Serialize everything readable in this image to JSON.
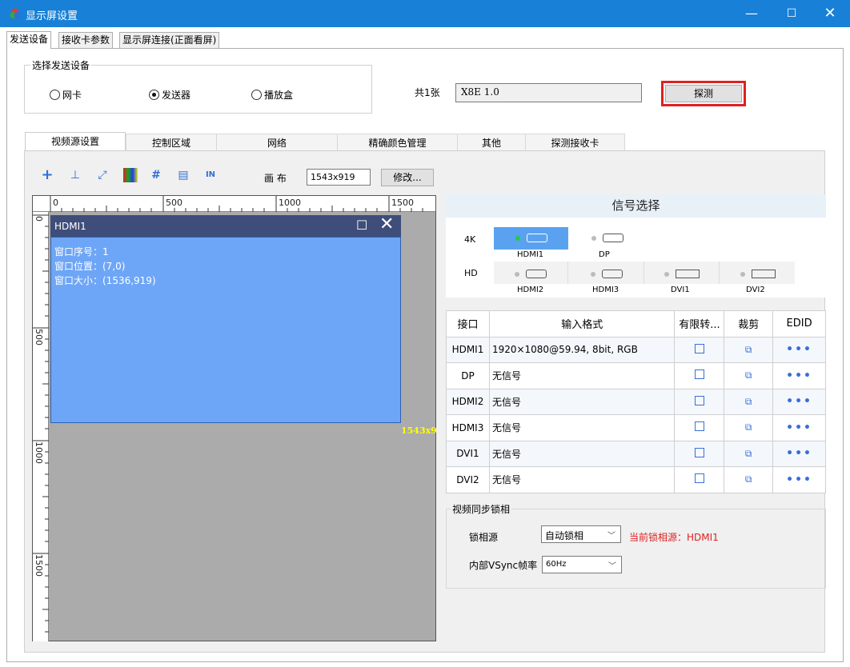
{
  "window": {
    "title": "显示屏设置",
    "min": "—",
    "max": "☐",
    "close": "✕"
  },
  "top_tabs": [
    "发送设备",
    "接收卡参数",
    "显示屏连接(正面看屏)"
  ],
  "device_group": {
    "title": "选择发送设备",
    "options": [
      "网卡",
      "发送器",
      "播放盒"
    ],
    "selected": "发送器",
    "count_label": "共1张",
    "model": "X8E 1.0",
    "detect_button": "探测"
  },
  "inner_tabs": [
    "视频源设置",
    "控制区域",
    "网络",
    "精确颜色管理",
    "其他",
    "探测接收卡"
  ],
  "toolbar": {
    "icons": [
      "add-icon",
      "import-icon",
      "fit-icon",
      "color-bar-icon",
      "grid-icon",
      "layout-icon",
      "input-icon"
    ],
    "canvas_label": "画 布",
    "canvas_size": "1543x919",
    "modify_button": "修改..."
  },
  "ruler": {
    "top": [
      "0",
      "500",
      "1000",
      "1500"
    ],
    "left": [
      "0",
      "500",
      "1000",
      "1500"
    ]
  },
  "window_item": {
    "name": "HDMI1",
    "index": "窗口序号：1",
    "position": "窗口位置：(7,0)",
    "size": "窗口大小：(1536,919)",
    "canvas_overlay": "1543x9"
  },
  "signal": {
    "title": "信号选择",
    "row_4k": "4K",
    "row_hd": "HD",
    "ports_4k": [
      "HDMI1",
      "DP"
    ],
    "ports_hd": [
      "HDMI2",
      "HDMI3",
      "DVI1",
      "DVI2"
    ],
    "active": "HDMI1"
  },
  "table": {
    "headers": [
      "接口",
      "输入格式",
      "有限转...",
      "裁剪",
      "EDID"
    ],
    "rows": [
      {
        "port": "HDMI1",
        "format": "1920×1080@59.94, 8bit, RGB"
      },
      {
        "port": "DP",
        "format": "无信号"
      },
      {
        "port": "HDMI2",
        "format": "无信号"
      },
      {
        "port": "HDMI3",
        "format": "无信号"
      },
      {
        "port": "DVI1",
        "format": "无信号"
      },
      {
        "port": "DVI2",
        "format": "无信号"
      }
    ],
    "crop_glyph": "⧉",
    "edid_glyph": "•••"
  },
  "sync": {
    "title": "视频同步锁相",
    "lock_label": "锁相源",
    "lock_value": "自动锁相",
    "current": "当前锁相源：HDMI1",
    "vsync_label": "内部VSync帧率",
    "vsync_value": "60Hz"
  },
  "colors": {
    "titlebar": "#1880d6",
    "window_title": "#3f4d7a",
    "window_body": "#6ea6f7",
    "highlight": "#e02020",
    "accent": "#3a6fd8"
  }
}
